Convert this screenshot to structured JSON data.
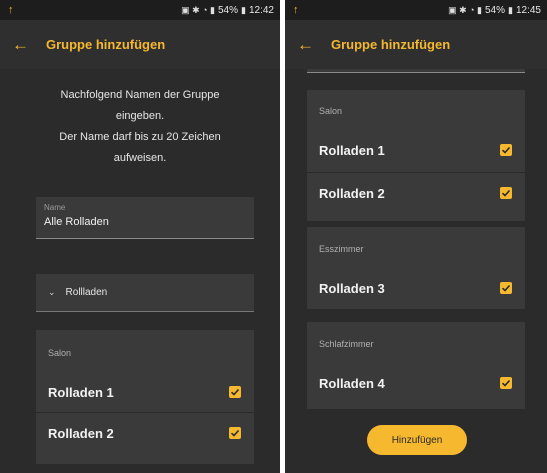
{
  "left": {
    "status": {
      "left_icon": "↑",
      "right_text": "54%",
      "time": "12:42"
    },
    "appbar": {
      "title": "Gruppe hinzufügen"
    },
    "intro": [
      "Nachfolgend Namen der Gruppe",
      "eingeben.",
      "Der Name darf bis zu 20 Zeichen",
      "aufweisen."
    ],
    "name_field": {
      "label": "Name",
      "value": "Alle Rolladen"
    },
    "dropdown": {
      "label": "Rollladen"
    },
    "group": {
      "category": "Salon",
      "items": [
        {
          "label": "Rolladen 1",
          "checked": true
        },
        {
          "label": "Rolladen 2",
          "checked": true
        }
      ]
    }
  },
  "right": {
    "status": {
      "left_icon": "↑",
      "right_text": "54%",
      "time": "12:45"
    },
    "appbar": {
      "title": "Gruppe hinzufügen"
    },
    "groups": [
      {
        "category": "Salon",
        "items": [
          {
            "label": "Rolladen 1",
            "checked": true
          },
          {
            "label": "Rolladen 2",
            "checked": true
          }
        ]
      },
      {
        "category": "Esszimmer",
        "items": [
          {
            "label": "Rolladen 3",
            "checked": true
          }
        ]
      },
      {
        "category": "Schlafzimmer",
        "items": [
          {
            "label": "Rolladen 4",
            "checked": true
          }
        ]
      }
    ],
    "add_button": {
      "label": "Hinzufügen"
    }
  },
  "colors": {
    "accent": "#f5b82e",
    "background": "#2b2b2b",
    "card": "#3a3a3a"
  }
}
